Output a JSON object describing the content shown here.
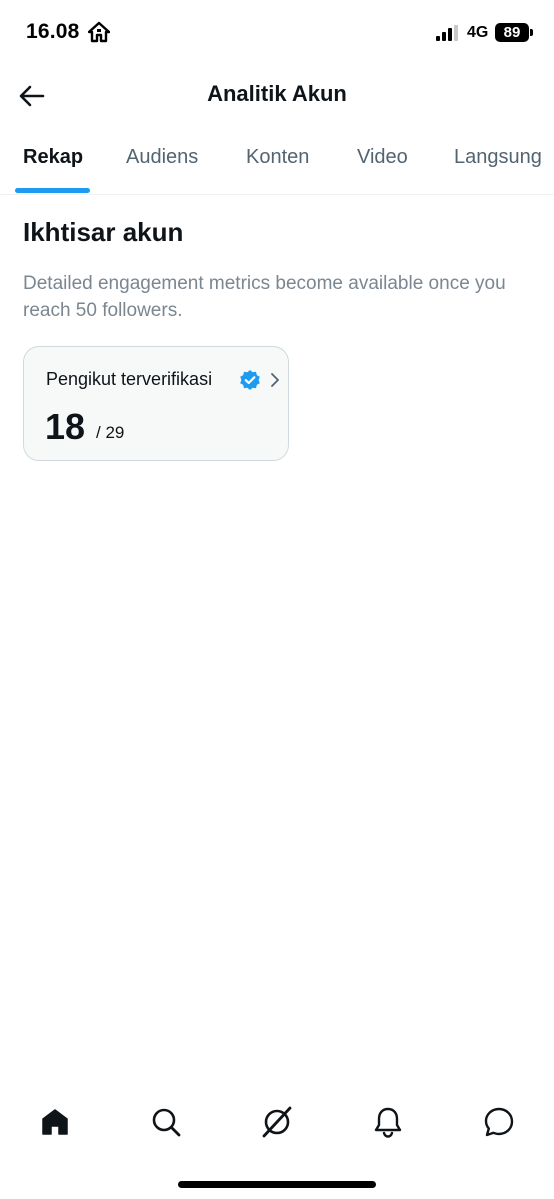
{
  "status_bar": {
    "time": "16.08",
    "network": "4G",
    "battery": "89"
  },
  "header": {
    "title": "Analitik Akun"
  },
  "tabs": [
    {
      "label": "Rekap",
      "active": true
    },
    {
      "label": "Audiens",
      "active": false
    },
    {
      "label": "Konten",
      "active": false
    },
    {
      "label": "Video",
      "active": false
    },
    {
      "label": "Langsung",
      "active": false
    }
  ],
  "overview": {
    "title": "Ikhtisar akun",
    "description": "Detailed engagement metrics become available once you reach 50 followers."
  },
  "metric_card": {
    "label": "Pengikut terverifikasi",
    "value": "18",
    "total": "/ 29"
  },
  "bottom_nav": [
    {
      "icon": "home-icon",
      "active": true
    },
    {
      "icon": "search-icon",
      "active": false
    },
    {
      "icon": "grok-icon",
      "active": false
    },
    {
      "icon": "bell-icon",
      "active": false
    },
    {
      "icon": "messages-icon",
      "active": false
    }
  ],
  "colors": {
    "accent": "#1d9bf0",
    "text_primary": "#0f1419",
    "text_secondary": "#536471"
  }
}
